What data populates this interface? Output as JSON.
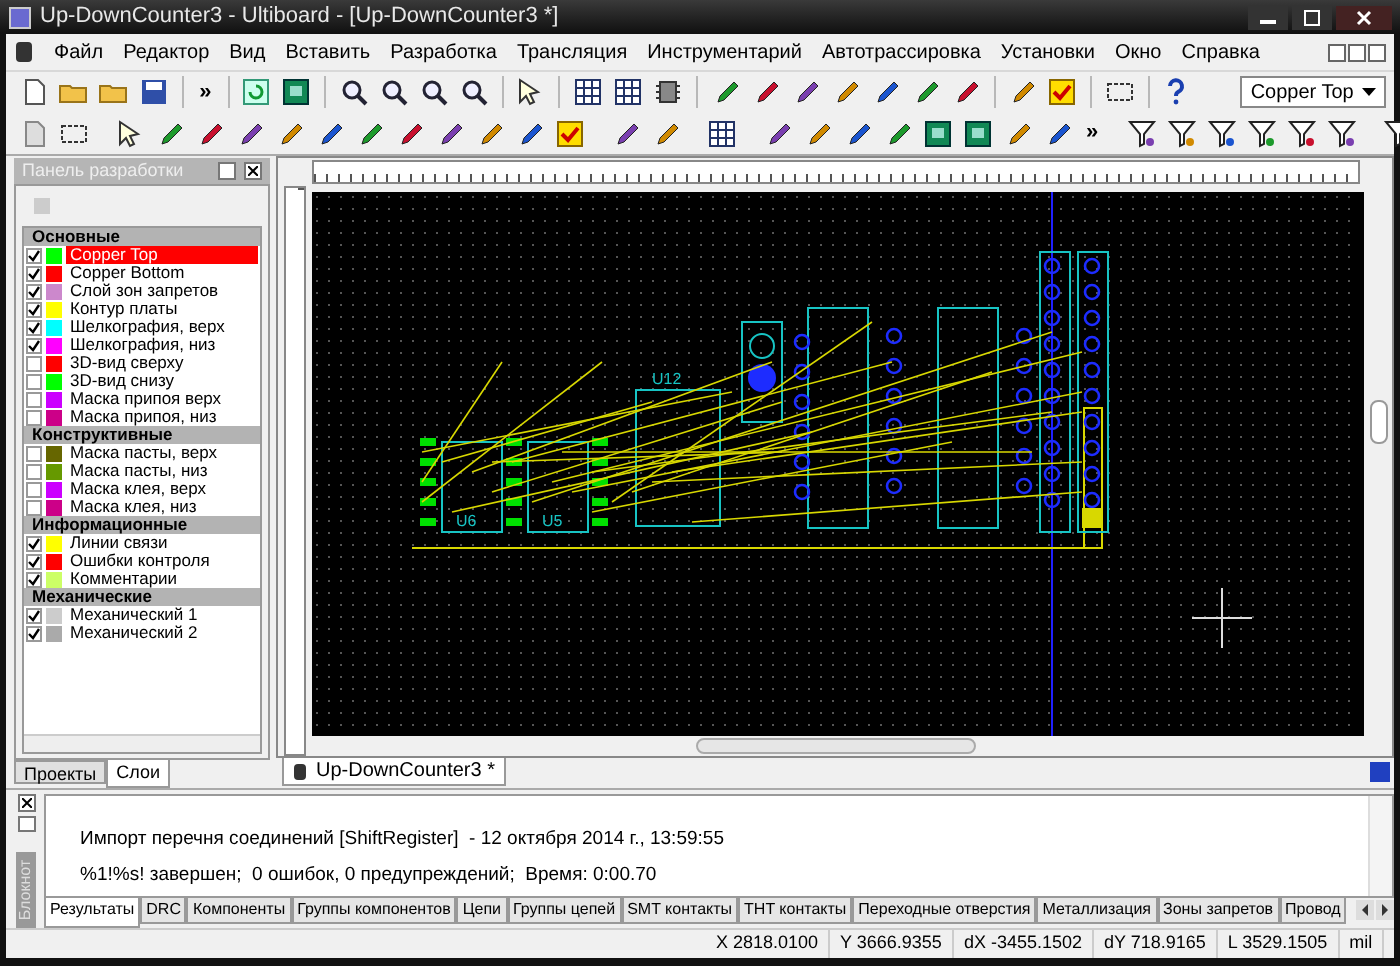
{
  "window": {
    "title": "Up-DownCounter3 - Ultiboard - [Up-DownCounter3 *]"
  },
  "menu": [
    "Файл",
    "Редактор",
    "Вид",
    "Вставить",
    "Разработка",
    "Трансляция",
    "Инструментарий",
    "Автотрассировка",
    "Установки",
    "Окно",
    "Справка"
  ],
  "toolbar": {
    "overflow_1": "»",
    "overflow_2": "»",
    "layer_dropdown": "Copper Top"
  },
  "design_panel": {
    "title": "Панель разработки",
    "groups": [
      {
        "name": "Основные",
        "items": [
          {
            "name": "Copper Top",
            "color": "#00ff00",
            "checked": true,
            "selected": true
          },
          {
            "name": "Copper Bottom",
            "color": "#ff0000",
            "checked": true,
            "selected": false
          },
          {
            "name": "Слой зон запретов",
            "color": "#cc88cc",
            "checked": true,
            "selected": false
          },
          {
            "name": "Контур платы",
            "color": "#ffff00",
            "checked": true,
            "selected": false
          },
          {
            "name": "Шелкография, верх",
            "color": "#00ffff",
            "checked": true,
            "selected": false
          },
          {
            "name": "Шелкография, низ",
            "color": "#ff00ff",
            "checked": true,
            "selected": false
          },
          {
            "name": "3D-вид сверху",
            "color": "#ff0000",
            "checked": false,
            "selected": false
          },
          {
            "name": "3D-вид снизу",
            "color": "#00ff00",
            "checked": false,
            "selected": false
          },
          {
            "name": "Маска припоя верх",
            "color": "#cc00ff",
            "checked": false,
            "selected": false
          },
          {
            "name": "Маска припоя, низ",
            "color": "#cc0088",
            "checked": false,
            "selected": false
          }
        ]
      },
      {
        "name": "Конструктивные",
        "items": [
          {
            "name": "Маска пасты, верх",
            "color": "#666600",
            "checked": false,
            "selected": false
          },
          {
            "name": "Маска пасты, низ",
            "color": "#669900",
            "checked": false,
            "selected": false
          },
          {
            "name": "Маска клея, верх",
            "color": "#cc00ff",
            "checked": false,
            "selected": false
          },
          {
            "name": "Маска клея, низ",
            "color": "#cc0088",
            "checked": false,
            "selected": false
          }
        ]
      },
      {
        "name": "Информационные",
        "items": [
          {
            "name": "Линии связи",
            "color": "#ffff00",
            "checked": true,
            "selected": false
          },
          {
            "name": "Ошибки контроля",
            "color": "#ff0000",
            "checked": true,
            "selected": false
          },
          {
            "name": "Комментарии",
            "color": "#ccff66",
            "checked": true,
            "selected": false
          }
        ]
      },
      {
        "name": "Механические",
        "items": [
          {
            "name": "Механический 1",
            "color": "#cccccc",
            "checked": true,
            "selected": false
          },
          {
            "name": "Механический 2",
            "color": "#aaaaaa",
            "checked": true,
            "selected": false
          }
        ]
      }
    ],
    "tabs": [
      {
        "label": "Проекты",
        "selected": false
      },
      {
        "label": "Слои",
        "selected": true
      }
    ]
  },
  "board": {
    "labels": [
      "U12",
      "U6",
      "U5"
    ]
  },
  "document_tabs": [
    {
      "label": "Up-DownCounter3 *",
      "selected": true
    }
  ],
  "output": {
    "side_label": "Блокнот",
    "lines": [
      "Импорт перечня соединений [ShiftRegister]  - 12 октября 2014 г., 13:59:55",
      "%1!%s! завершен;  0 ошибок, 0 предупреждений;  Время: 0:00.70"
    ],
    "tabs": [
      {
        "label": "Результаты",
        "selected": true
      },
      {
        "label": "DRC",
        "selected": false
      },
      {
        "label": "Компоненты",
        "selected": false
      },
      {
        "label": "Группы компонентов",
        "selected": false
      },
      {
        "label": "Цепи",
        "selected": false
      },
      {
        "label": "Группы цепей",
        "selected": false
      },
      {
        "label": "SMT контакты",
        "selected": false
      },
      {
        "label": "THT контакты",
        "selected": false
      },
      {
        "label": "Переходные отверстия",
        "selected": false
      },
      {
        "label": "Металлизация",
        "selected": false
      },
      {
        "label": "Зоны запретов",
        "selected": false
      },
      {
        "label": "Провод",
        "selected": false
      }
    ]
  },
  "status_bar": [
    "X 2818.0100",
    "Y 3666.9355",
    "dX -3455.1502",
    "dY 718.9165",
    "L 3529.1505",
    "mil"
  ]
}
